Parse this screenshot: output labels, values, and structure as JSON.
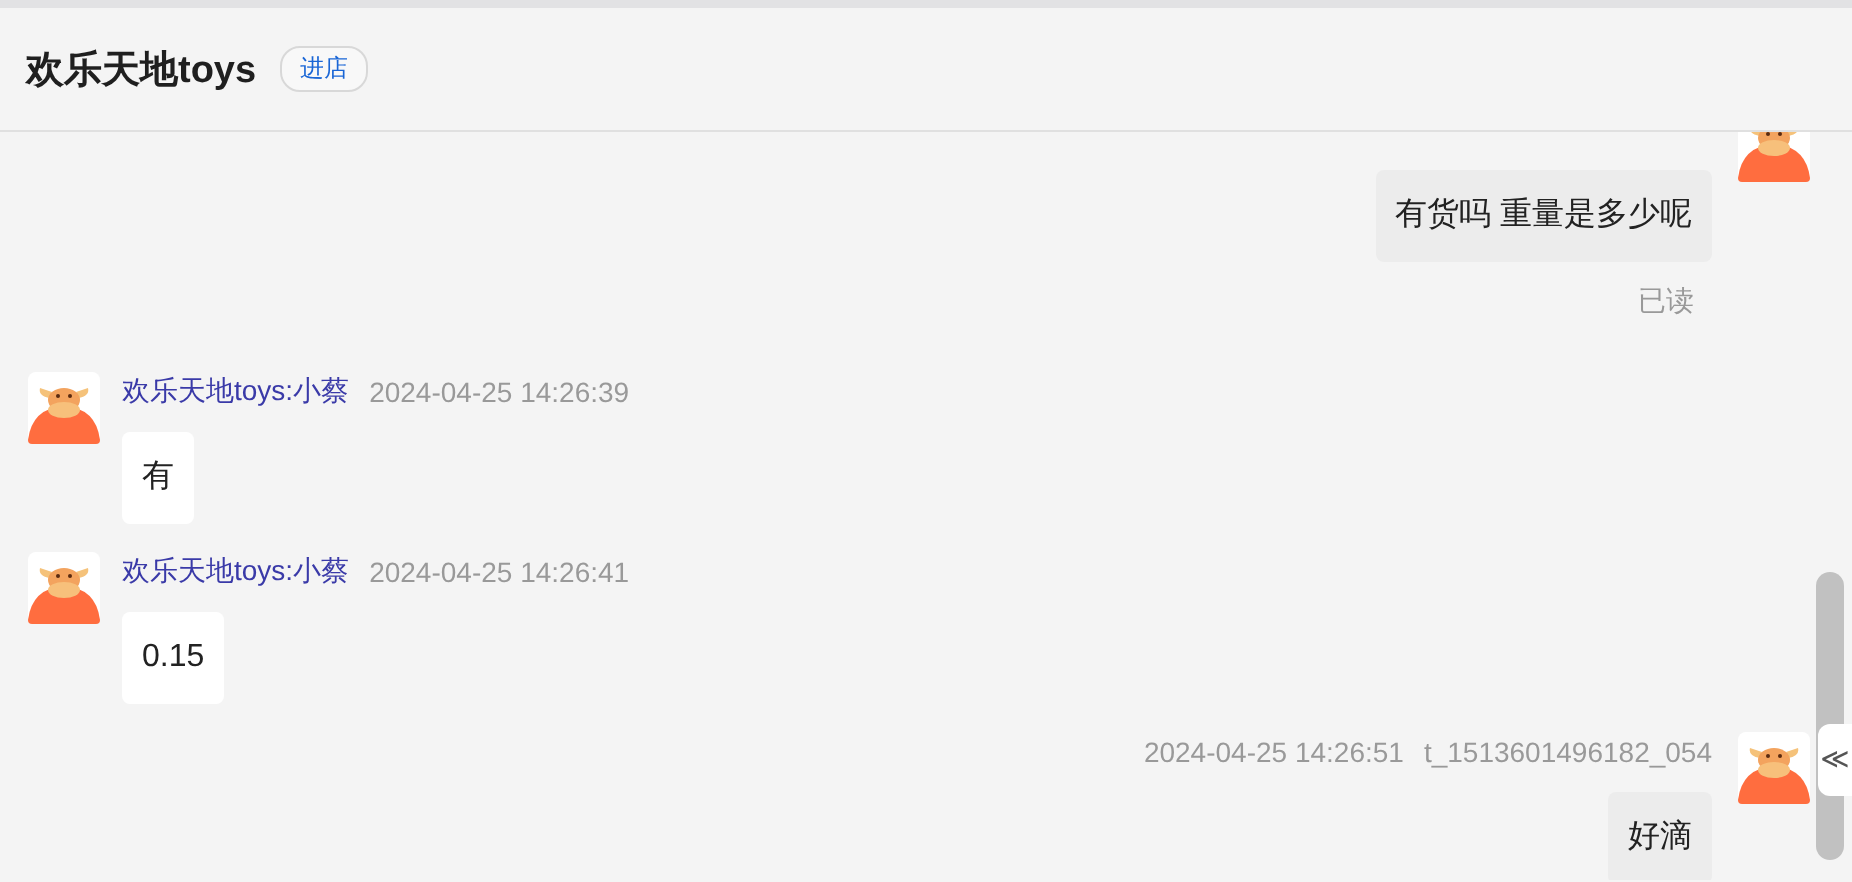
{
  "header": {
    "title": "欢乐天地toys",
    "badge": "进店"
  },
  "messages": [
    {
      "kind": "self",
      "text": "有货吗 重量是多少呢",
      "read_status": "已读"
    },
    {
      "kind": "other",
      "sender": "欢乐天地toys:小蔡",
      "time": "2024-04-25 14:26:39",
      "text": "有"
    },
    {
      "kind": "other",
      "sender": "欢乐天地toys:小蔡",
      "time": "2024-04-25 14:26:41",
      "text": "0.15"
    },
    {
      "kind": "self",
      "time": "2024-04-25 14:26:51",
      "user_id": "t_1513601496182_054",
      "text": "好滴"
    }
  ],
  "collapse_button": "≪"
}
